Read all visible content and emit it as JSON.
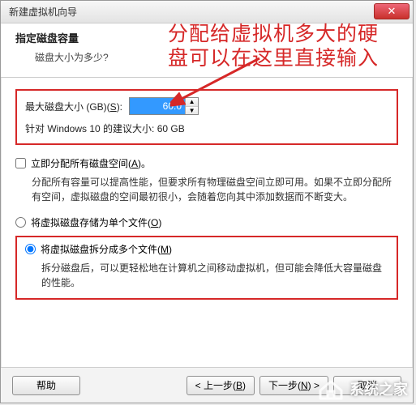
{
  "colors": {
    "annotation": "#d62828"
  },
  "window": {
    "title": "新建虚拟机向导",
    "close_glyph": "✕"
  },
  "header": {
    "title": "指定磁盘容量",
    "subtitle": "磁盘大小为多少?"
  },
  "disk_size": {
    "label_prefix": "最大磁盘大小 (GB)(",
    "label_key": "S",
    "label_suffix": "):",
    "value": "60.0",
    "recommend": "针对 Windows 10 的建议大小: 60 GB"
  },
  "allocate_now": {
    "checked": false,
    "label_prefix": "立即分配所有磁盘空间(",
    "label_key": "A",
    "label_suffix": ")。",
    "desc": "分配所有容量可以提高性能，但要求所有物理磁盘空间立即可用。如果不立即分配所有空间，虚拟磁盘的空间最初很小，会随着您向其中添加数据而不断变大。"
  },
  "store_as": {
    "single": {
      "checked": false,
      "label_prefix": "将虚拟磁盘存储为单个文件(",
      "label_key": "O",
      "label_suffix": ")"
    },
    "split": {
      "checked": true,
      "label_prefix": "将虚拟磁盘拆分成多个文件(",
      "label_key": "M",
      "label_suffix": ")",
      "desc": "拆分磁盘后，可以更轻松地在计算机之间移动虚拟机，但可能会降低大容量磁盘的性能。"
    }
  },
  "buttons": {
    "help": "帮助",
    "back_prefix": "< 上一步(",
    "back_key": "B",
    "back_suffix": ")",
    "next_prefix": "下一步(",
    "next_key": "N",
    "next_suffix": ") >",
    "cancel": "取消"
  },
  "annotation": {
    "line1": "分配给虚拟机多大的硬",
    "line2": "盘可以在这里直接输入"
  },
  "watermark": {
    "text": "系统之家"
  }
}
